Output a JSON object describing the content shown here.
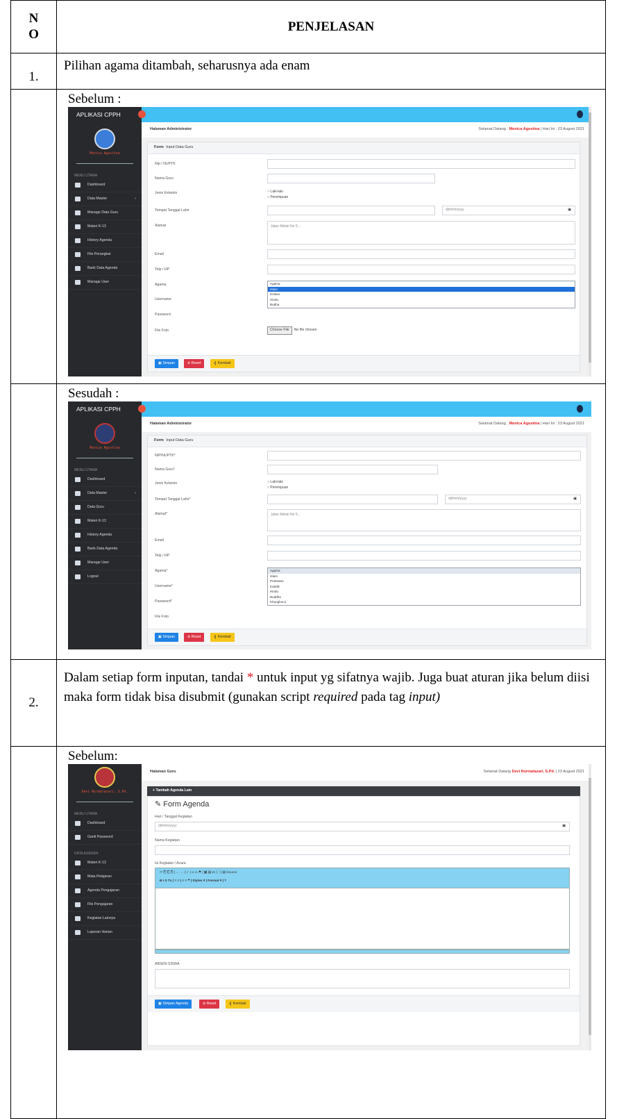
{
  "table": {
    "header_no": "N O",
    "header_no_line1": "N",
    "header_no_line2": "O",
    "header_title": "PENJELASAN"
  },
  "item1": {
    "no": "1.",
    "text": "Pilihan agama ditambah, seharusnya ada enam"
  },
  "item2": {
    "no": "2.",
    "text_part1": "Dalam setiap form inputan, tandai ",
    "asterisk": "*",
    "text_part2": " untuk input yg sifatnya wajib. Juga buat aturan jika belum diisi maka form tidak bisa disubmit (gunakan script ",
    "required_word": "required",
    "text_part3": " pada tag ",
    "input_word": "input)"
  },
  "labels": {
    "before": "Sebelum :",
    "after": "Sesudah :",
    "before2": "Sebelum:"
  },
  "colors": {
    "topbar": "#42c0f3",
    "sidebar": "#27292d",
    "asterisk": "#e0202a"
  },
  "shot1": {
    "brand": "APLIKASI CPPH",
    "user": "Monica Agustina",
    "menu_header": "MENU UTAMA",
    "menu": [
      "Dashboard",
      "Data Master",
      "Manage Data Guru",
      "Materi K-13",
      "History Agenda",
      "File Perangkat",
      "Bank Data Agenda",
      "Manage User"
    ],
    "page_title": "Halaman Administrator",
    "greet_prefix": "Selamat Datang :",
    "greet_name": "Monica Agustina",
    "greet_date": "Hari Ini : 23 August 2021",
    "card_title_bold": "Form",
    "card_title": "Input Data Guru",
    "fields": [
      "Nip / NUPTK",
      "Nama Guru",
      "Jenis Kelamin",
      "Tempat Tanggal Lahir",
      "Alamat",
      "Email",
      "Telp / HP",
      "Agama",
      "Username",
      "Password",
      "File Foto"
    ],
    "radio": [
      "○ Laki-laki",
      "○ Perempuan"
    ],
    "date_placeholder": "dd/mm/yyyy",
    "address_placeholder": "Jalan Melati No 5...",
    "religion_options": [
      "Agama",
      "Islam",
      "Kristen",
      "Hindu",
      "Budha"
    ],
    "file_button": "Choose File",
    "file_status": "No file chosen",
    "buttons": [
      "Simpan",
      "Reset",
      "Kembali"
    ]
  },
  "shot2": {
    "brand": "APLIKASI CPPH",
    "user": "Monica Agustina",
    "menu_header": "MENU UTAMA",
    "menu": [
      "Dashboard",
      "Data Master",
      "Data Guru",
      "Materi K-13",
      "History Agenda",
      "Bank Data Agenda",
      "Manage User",
      "Logout"
    ],
    "page_title": "Halaman Administrator",
    "greet_prefix": "Selamat Datang ,",
    "greet_name": "Monica Agustina",
    "greet_date": "Hari Ini : 23 August 2021",
    "card_title_bold": "Form",
    "card_title": "Input Data Guru",
    "fields": [
      "NIP/NUPTK*",
      "Nama Guru*",
      "Jenis Kelamin",
      "Tempat Tanggal Lahir*",
      "Alamat*",
      "Email",
      "Telp / HP",
      "Agama*",
      "Username*",
      "Password*",
      "File Foto"
    ],
    "radio": [
      "○ Laki-laki",
      "○ Perempuan"
    ],
    "date_placeholder": "dd/mm/yyyy",
    "address_placeholder": "Jalan Melati No 5...",
    "religion_options": [
      "Agama",
      "Islam",
      "Protestan",
      "Katolik",
      "Hindu",
      "Buddha",
      "Khonghucu"
    ],
    "buttons": [
      "Simpan",
      "Reset",
      "Kembali"
    ]
  },
  "shot3": {
    "user": "Devi Nurmalasari, S.Pd.",
    "menu_header": "MENU UTAMA",
    "menu": [
      "Dashboard",
      "Ganti Password"
    ],
    "menu_header2": "DATA AGENDA",
    "menu2": [
      "Materi K-13",
      "Mata Pelajaran",
      "Agenda Pengajaran",
      "File Pengajaran",
      "Kegiatan Lainnya",
      "Laporan Harian"
    ],
    "page_title": "Halaman Guru",
    "greet_prefix": "Selamat Datang",
    "greet_name": "Devi Nurmalasari, S.Pd.",
    "greet_date": "23 August 2021",
    "add_bar": "+ Tambah Agenda Lain",
    "form_title": "Form Agenda",
    "fields": [
      "Hari / Tanggal Kegiatan",
      "Nama Kegiatan",
      "Isi Kegiatan / Acara",
      "ABSEN SISWA"
    ],
    "date_placeholder": "dd/mm/yyyy",
    "editor_row1": "✂ ⎘ ⎗ ⎘ | ← → | ✓ | ∞ ∞ ⚑ | ▦ ▤ Ω | ⛶ | ▤ Source",
    "editor_row2": "B I S Tx | ≡ ≡ | ≡ ≡ ❝ | Styles   ▾ | Format   ▾ | ?",
    "buttons": [
      "Simpan Agenda",
      "Reset",
      "Kembali"
    ]
  }
}
